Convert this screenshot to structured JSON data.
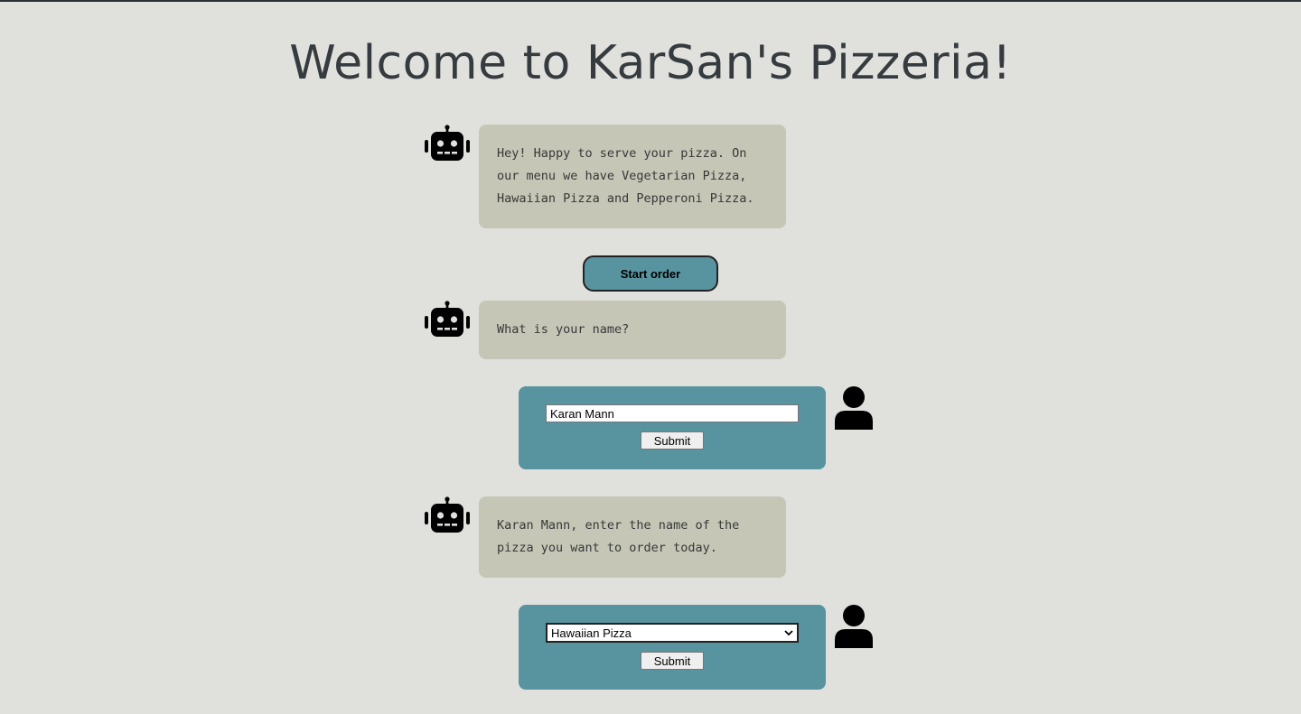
{
  "page": {
    "title": "Welcome to KarSan's Pizzeria!"
  },
  "messages": {
    "greeting": "Hey! Happy to serve your pizza. On our menu we have Vegetarian Pizza, Hawaiian Pizza and Pepperoni Pizza.",
    "ask_name": "What is your name?",
    "ask_pizza": "Karan Mann, enter the name of the pizza you want to order today."
  },
  "start_button": {
    "label": "Start order"
  },
  "name_form": {
    "value": "Karan Mann",
    "submit_label": "Submit"
  },
  "pizza_form": {
    "selected": "Hawaiian Pizza",
    "submit_label": "Submit"
  },
  "icons": {
    "bot": "robot-icon",
    "user": "user-icon"
  },
  "colors": {
    "background": "#e0e1dd",
    "bot_bubble": "#c5c6b6",
    "user_bubble": "#5893a0",
    "title": "#363b3f"
  }
}
